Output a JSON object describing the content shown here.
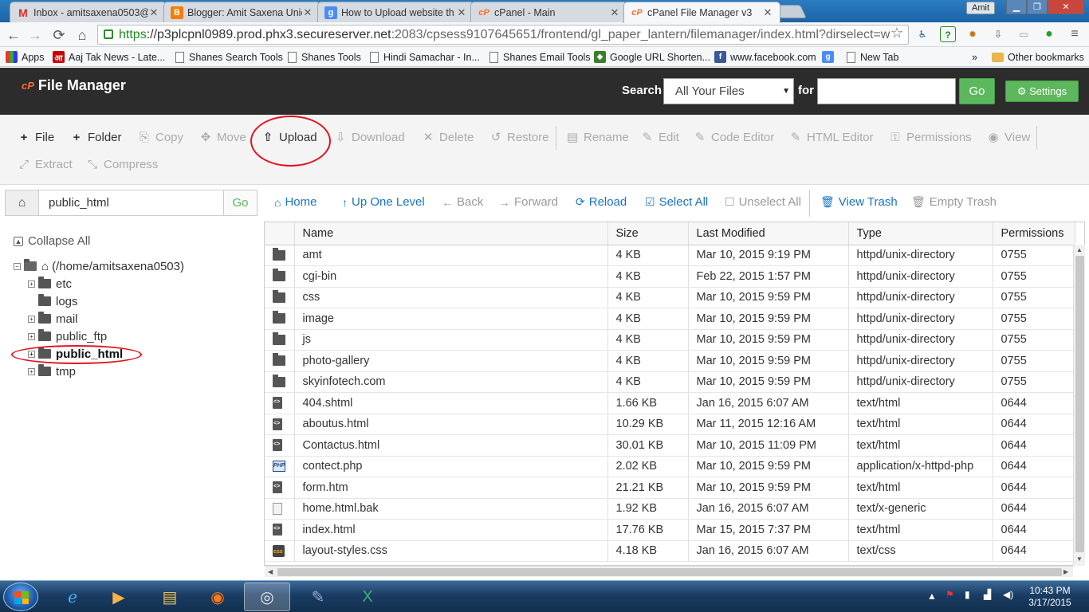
{
  "browser": {
    "tabs": [
      {
        "title": "Inbox - amitsaxena0503@",
        "icon": "gmail-icon",
        "active": false
      },
      {
        "title": "Blogger: Amit Saxena Unic",
        "icon": "blogger-icon",
        "active": false
      },
      {
        "title": "How to Upload website th",
        "icon": "google-icon",
        "active": false
      },
      {
        "title": "cPanel - Main",
        "icon": "cpanel-icon",
        "active": false
      },
      {
        "title": "cPanel File Manager v3",
        "icon": "cpanel-icon",
        "active": true
      }
    ],
    "user_badge": "Amit",
    "url_scheme": "https",
    "url_host": "://p3plcpnl0989.prod.phx3.secureserver.net",
    "url_rest": ":2083/cpsess9107645651/frontend/gl_paper_lantern/filemanager/index.html?dirselect=w",
    "bookmarks": [
      {
        "label": "Apps",
        "icon": "apps-icon"
      },
      {
        "label": "Aaj Tak News - Late...",
        "icon": "aajtak-icon"
      },
      {
        "label": "Shanes Search Tools",
        "icon": "page-icon"
      },
      {
        "label": "Shanes Tools",
        "icon": "page-icon"
      },
      {
        "label": "Hindi Samachar - In...",
        "icon": "page-icon"
      },
      {
        "label": "Shanes Email Tools",
        "icon": "page-icon"
      },
      {
        "label": "Google URL Shorten...",
        "icon": "google-url-icon"
      },
      {
        "label": "www.facebook.com",
        "icon": "facebook-icon"
      },
      {
        "label": "",
        "icon": "google-icon"
      },
      {
        "label": "New Tab",
        "icon": "page-icon"
      }
    ],
    "bookmarks_overflow": "»",
    "other_bookmarks": "Other bookmarks"
  },
  "header": {
    "logo_mark": "cP",
    "title": "File Manager",
    "search_label": "Search",
    "search_scope": "All Your Files",
    "for_label": "for",
    "search_placeholder": "",
    "go_label": "Go",
    "settings_label": "Settings"
  },
  "actions": [
    {
      "label": "File",
      "icon": "+",
      "enabled": true
    },
    {
      "label": "Folder",
      "icon": "+",
      "enabled": true
    },
    {
      "label": "Copy",
      "icon": "⎘",
      "enabled": false
    },
    {
      "label": "Move",
      "icon": "✥",
      "enabled": false
    },
    {
      "label": "Upload",
      "icon": "⇧",
      "enabled": true
    },
    {
      "label": "Download",
      "icon": "⇩",
      "enabled": false
    },
    {
      "label": "Delete",
      "icon": "✕",
      "enabled": false
    },
    {
      "label": "Restore",
      "icon": "↺",
      "enabled": false
    },
    {
      "label": "Rename",
      "icon": "▤",
      "enabled": false
    },
    {
      "label": "Edit",
      "icon": "✎",
      "enabled": false
    },
    {
      "label": "Code Editor",
      "icon": "✎",
      "enabled": false
    },
    {
      "label": "HTML Editor",
      "icon": "✎",
      "enabled": false
    },
    {
      "label": "Permissions",
      "icon": "⚿",
      "enabled": false
    },
    {
      "label": "View",
      "icon": "◉",
      "enabled": false
    },
    {
      "label": "Extract",
      "icon": "⤢",
      "enabled": false
    },
    {
      "label": "Compress",
      "icon": "⤡",
      "enabled": false
    }
  ],
  "pathbar": {
    "value": "public_html",
    "go_label": "Go"
  },
  "nav": [
    {
      "label": "Home",
      "icon": "⌂",
      "enabled": true
    },
    {
      "label": "Up One Level",
      "icon": "↑",
      "enabled": true
    },
    {
      "label": "Back",
      "icon": "←",
      "enabled": false
    },
    {
      "label": "Forward",
      "icon": "→",
      "enabled": false
    },
    {
      "label": "Reload",
      "icon": "⟳",
      "enabled": true
    },
    {
      "label": "Select All",
      "icon": "☑",
      "enabled": true
    },
    {
      "label": "Unselect All",
      "icon": "☐",
      "enabled": false
    },
    {
      "label": "View Trash",
      "icon": "🗑",
      "enabled": true
    },
    {
      "label": "Empty Trash",
      "icon": "🗑",
      "enabled": false
    }
  ],
  "tree": {
    "collapse_label": "Collapse All",
    "root": "(/home/amitsaxena0503)",
    "items": [
      {
        "label": "etc",
        "expandable": true,
        "selected": false
      },
      {
        "label": "logs",
        "expandable": false,
        "selected": false
      },
      {
        "label": "mail",
        "expandable": true,
        "selected": false
      },
      {
        "label": "public_ftp",
        "expandable": true,
        "selected": false
      },
      {
        "label": "public_html",
        "expandable": true,
        "selected": true
      },
      {
        "label": "tmp",
        "expandable": true,
        "selected": false
      }
    ]
  },
  "table": {
    "columns": [
      "",
      "Name",
      "Size",
      "Last Modified",
      "Type",
      "Permissions"
    ],
    "rows": [
      {
        "icon": "dir",
        "name": "amt",
        "size": "4 KB",
        "modified": "Mar 10, 2015 9:19 PM",
        "type": "httpd/unix-directory",
        "perms": "0755"
      },
      {
        "icon": "dir",
        "name": "cgi-bin",
        "size": "4 KB",
        "modified": "Feb 22, 2015 1:57 PM",
        "type": "httpd/unix-directory",
        "perms": "0755"
      },
      {
        "icon": "dir",
        "name": "css",
        "size": "4 KB",
        "modified": "Mar 10, 2015 9:59 PM",
        "type": "httpd/unix-directory",
        "perms": "0755"
      },
      {
        "icon": "dir",
        "name": "image",
        "size": "4 KB",
        "modified": "Mar 10, 2015 9:59 PM",
        "type": "httpd/unix-directory",
        "perms": "0755"
      },
      {
        "icon": "dir",
        "name": "js",
        "size": "4 KB",
        "modified": "Mar 10, 2015 9:59 PM",
        "type": "httpd/unix-directory",
        "perms": "0755"
      },
      {
        "icon": "dir",
        "name": "photo-gallery",
        "size": "4 KB",
        "modified": "Mar 10, 2015 9:59 PM",
        "type": "httpd/unix-directory",
        "perms": "0755"
      },
      {
        "icon": "dir",
        "name": "skyinfotech.com",
        "size": "4 KB",
        "modified": "Mar 10, 2015 9:59 PM",
        "type": "httpd/unix-directory",
        "perms": "0755"
      },
      {
        "icon": "html",
        "name": "404.shtml",
        "size": "1.66 KB",
        "modified": "Jan 16, 2015 6:07 AM",
        "type": "text/html",
        "perms": "0644"
      },
      {
        "icon": "html",
        "name": "aboutus.html",
        "size": "10.29 KB",
        "modified": "Mar 11, 2015 12:16 AM",
        "type": "text/html",
        "perms": "0644"
      },
      {
        "icon": "html",
        "name": "Contactus.html",
        "size": "30.01 KB",
        "modified": "Mar 10, 2015 11:09 PM",
        "type": "text/html",
        "perms": "0644"
      },
      {
        "icon": "php",
        "name": "contect.php",
        "size": "2.02 KB",
        "modified": "Mar 10, 2015 9:59 PM",
        "type": "application/x-httpd-php",
        "perms": "0644"
      },
      {
        "icon": "html",
        "name": "form.htm",
        "size": "21.21 KB",
        "modified": "Mar 10, 2015 9:59 PM",
        "type": "text/html",
        "perms": "0644"
      },
      {
        "icon": "gen",
        "name": "home.html.bak",
        "size": "1.92 KB",
        "modified": "Jan 16, 2015 6:07 AM",
        "type": "text/x-generic",
        "perms": "0644"
      },
      {
        "icon": "html",
        "name": "index.html",
        "size": "17.76 KB",
        "modified": "Mar 15, 2015 7:37 PM",
        "type": "text/html",
        "perms": "0644"
      },
      {
        "icon": "css",
        "name": "layout-styles.css",
        "size": "4.18 KB",
        "modified": "Jan 16, 2015 6:07 AM",
        "type": "text/css",
        "perms": "0644"
      }
    ]
  },
  "taskbar": {
    "apps": [
      "windows-explorer-icon",
      "internet-explorer-icon",
      "media-player-icon",
      "file-explorer-icon",
      "firefox-icon",
      "chrome-icon",
      "paint-icon",
      "excel-icon"
    ],
    "time": "10:43 PM",
    "date": "3/17/2015"
  },
  "colors": {
    "header_bg": "#2c2c2c",
    "accent_green": "#5cb85c",
    "link_blue": "#1a72c8",
    "annotation_red": "#e0141e"
  }
}
